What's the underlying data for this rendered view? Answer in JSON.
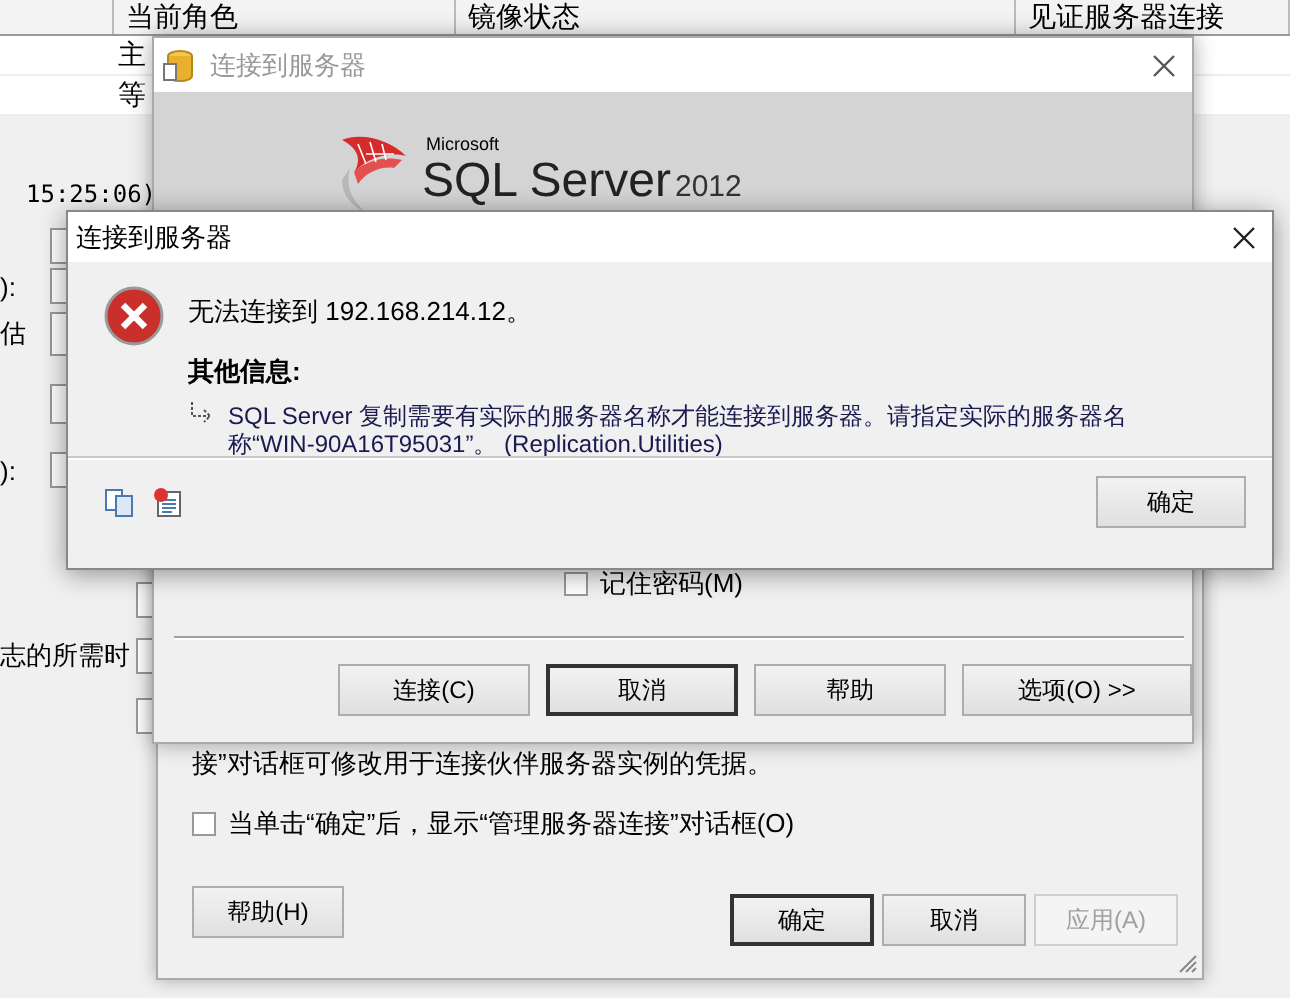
{
  "background_window": {
    "table": {
      "columns": [
        "当前角色",
        "镜像状态",
        "见证服务器连接"
      ],
      "rows": [
        [
          "主"
        ],
        [
          "等"
        ]
      ]
    },
    "timestamp": "15:25:06)",
    "form_rows": [
      {},
      {
        "label": "):"
      },
      {
        "label": "估"
      },
      {},
      {
        "label": "):"
      }
    ],
    "lower_rows": [
      {},
      {
        "label": "志的所需时"
      },
      {}
    ]
  },
  "properties_dialog": {
    "description": "接”对话框可修改用于连接伙伴服务器实例的凭据。",
    "show_dialog_checkbox": {
      "label": "当单击“确定”后，显示“管理服务器连接”对话框(O)",
      "checked": false
    },
    "help_button": "帮助(H)",
    "buttons": [
      {
        "label": "确定",
        "default": true,
        "disabled": false
      },
      {
        "label": "取消",
        "default": false,
        "disabled": false
      },
      {
        "label": "应用(A)",
        "default": false,
        "disabled": true
      }
    ]
  },
  "connect_dialog": {
    "title": "连接到服务器",
    "active": false,
    "logo": {
      "brand": "Microsoft",
      "product": "SQL Server",
      "version": "2012"
    },
    "remember_password": {
      "label": "记住密码(M)",
      "checked": false
    },
    "buttons": [
      {
        "label": "连接(C)",
        "default": false
      },
      {
        "label": "取消",
        "default": true
      },
      {
        "label": "帮助",
        "default": false
      },
      {
        "label": "选项(O) >>",
        "default": false
      }
    ]
  },
  "error_dialog": {
    "title": "连接到服务器",
    "message": "无法连接到 192.168.214.12。",
    "details_heading": "其他信息:",
    "detail": "SQL Server 复制需要有实际的服务器名称才能连接到服务器。请指定实际的服务器名称“WIN-90A16T95031”。 (Replication.Utilities)",
    "ok_button": "确定"
  }
}
